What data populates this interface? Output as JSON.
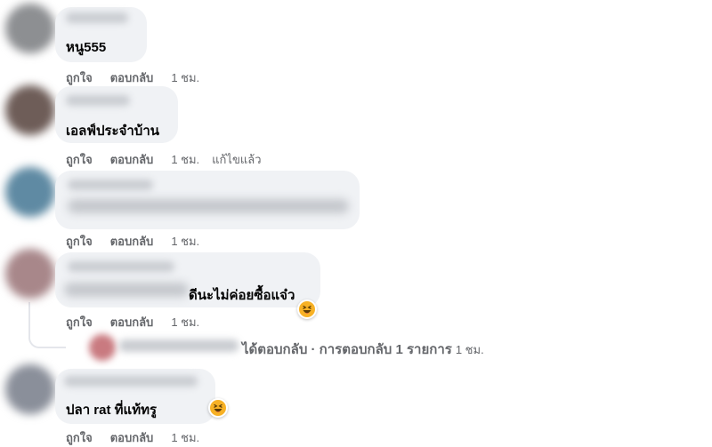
{
  "comments": [
    {
      "text": "หนู555",
      "actions": {
        "like": "ถูกใจ",
        "reply": "ตอบกลับ",
        "time": "1 ชม."
      }
    },
    {
      "text": "เอลฟ์ประจำบ้าน",
      "actions": {
        "like": "ถูกใจ",
        "reply": "ตอบกลับ",
        "time": "1 ชม.",
        "edited": "แก้ไขแล้ว"
      }
    },
    {
      "text": "",
      "actions": {
        "like": "ถูกใจ",
        "reply": "ตอบกลับ",
        "time": "1 ชม."
      }
    },
    {
      "text": "ดีนะไม่ค่อยซื้อแจ๋ว",
      "reaction": "haha",
      "actions": {
        "like": "ถูกใจ",
        "reply": "ตอบกลับ",
        "time": "1 ชม."
      }
    },
    {
      "text": "ปลา rat ที่แท้ทรู",
      "reaction": "haha",
      "actions": {
        "like": "ถูกใจ",
        "reply": "ตอบกลับ",
        "time": "1 ชม."
      }
    }
  ],
  "reply_summary": {
    "text": "ได้ตอบกลับ · การตอบกลับ 1 รายการ",
    "time": "1 ชม."
  },
  "colors": {
    "bubble": "#f0f2f5",
    "action_text": "#65676b",
    "text": "#050505",
    "reaction_yellow": "#f7b125"
  },
  "icons": {
    "reaction": "laughing-face-icon"
  }
}
